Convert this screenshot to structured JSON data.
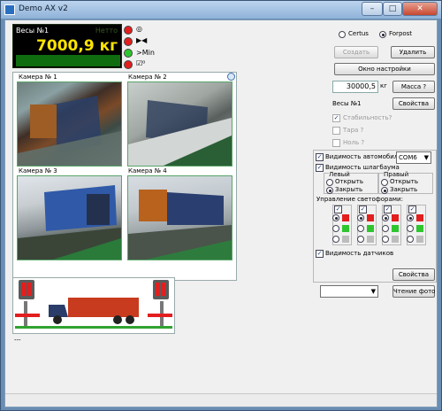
{
  "window": {
    "title": "Demo AX v2",
    "minimize_glyph": "–",
    "maximize_glyph": "□",
    "close_glyph": "✕",
    "close_color": "#d23b2a"
  },
  "scale_display": {
    "label": "Весы №1",
    "status": "Нетто",
    "value": "7000,9 кг",
    "value_color": "#ffe400"
  },
  "indicators": [
    {
      "color": "#e31e1e",
      "icon": "stability-indicator-icon",
      "glyph": "◎"
    },
    {
      "color": "#e31e1e",
      "icon": "zero-indicator-icon",
      "glyph": "▶◀"
    },
    {
      "color": "#2fc52f",
      "label": ">Min"
    },
    {
      "color": "#e31e1e",
      "icon": "check-indicator-icon",
      "glyph": "☑⁰"
    }
  ],
  "cameras": [
    {
      "label": "Камера № 1"
    },
    {
      "label": "Камера № 2"
    },
    {
      "label": "Камера № 3"
    },
    {
      "label": "Камера № 4"
    }
  ],
  "mode": {
    "option_1": "Certus",
    "option_2": "Forpost",
    "selected": "Forpost"
  },
  "buttons": {
    "create": "Создать",
    "delete": "Удалить",
    "settings_window": "Окно настройки",
    "mass": "Масса ?",
    "properties": "Свойства",
    "properties_2": "Свойства",
    "read_photo": "Чтение фото"
  },
  "mass_field": {
    "value": "30000,5",
    "unit": "кг"
  },
  "scale_name": "Весы №1",
  "checks": {
    "stability": "Стабильность?",
    "tare": "Тара ?",
    "zero": "Ноль ?"
  },
  "visibility": {
    "car": "Видимость автомобиля",
    "port": "COM6",
    "barrier": "Видимость шлагбаума",
    "sensors": "Видимость датчиков"
  },
  "barrier": {
    "left": "Левый",
    "right": "Правый",
    "open": "Открыть",
    "close": "Закрыть",
    "left_selected": "Закрыть",
    "right_selected": "Закрыть"
  },
  "traffic": {
    "title": "Управление светофорами:",
    "columns": 4,
    "colors": {
      "red": "#e31e1e",
      "green": "#2fc52f",
      "gray": "#bdbdbd"
    }
  },
  "bottom_combo": {
    "value": ""
  },
  "truck_caption": "---"
}
